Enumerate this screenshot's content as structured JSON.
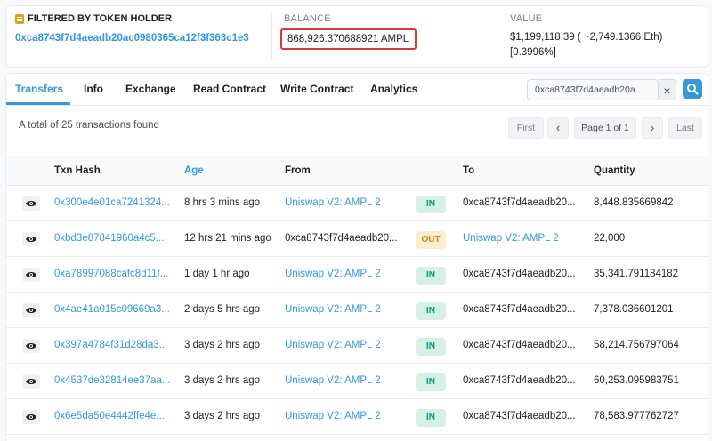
{
  "summary": {
    "filter_label": "FILTERED BY TOKEN HOLDER",
    "holder_address": "0xca8743f7d4aeadb20ac0980365ca12f3f363c1e3",
    "balance_label": "BALANCE",
    "balance_value": "868,926.370688921 AMPL",
    "value_label": "VALUE",
    "value_line1": "$1,199,118.39 ( ~2,749.1366 Eth)",
    "value_line2": "[0.3996%]"
  },
  "tabs": [
    "Transfers",
    "Info",
    "Exchange",
    "Read Contract",
    "Write Contract",
    "Analytics"
  ],
  "search": {
    "value": "0xca8743f7d4aeadb20a...",
    "clear": "×"
  },
  "found_text": "A total of 25 transactions found",
  "pager": {
    "first": "First",
    "prev": "‹",
    "info": "Page 1 of 1",
    "next": "›",
    "last": "Last"
  },
  "columns": {
    "hash": "Txn Hash",
    "age": "Age",
    "from": "From",
    "to": "To",
    "qty": "Quantity"
  },
  "rows": [
    {
      "hash": "0x300e4e01ca7241324...",
      "age": "8 hrs 3 mins ago",
      "from": "Uniswap V2: AMPL 2",
      "dir": "IN",
      "to": "0xca8743f7d4aeadb20...",
      "qty": "8,448.835669842"
    },
    {
      "hash": "0xbd3e87841960a4c5...",
      "age": "12 hrs 21 mins ago",
      "from": "0xca8743f7d4aeadb20...",
      "dir": "OUT",
      "to": "Uniswap V2: AMPL 2",
      "qty": "22,000"
    },
    {
      "hash": "0xa78997088cafc8d11f...",
      "age": "1 day 1 hr ago",
      "from": "Uniswap V2: AMPL 2",
      "dir": "IN",
      "to": "0xca8743f7d4aeadb20...",
      "qty": "35,341.791184182"
    },
    {
      "hash": "0x4ae41a015c09669a3...",
      "age": "2 days 5 hrs ago",
      "from": "Uniswap V2: AMPL 2",
      "dir": "IN",
      "to": "0xca8743f7d4aeadb20...",
      "qty": "7,378.036601201"
    },
    {
      "hash": "0x397a4784f31d28da3...",
      "age": "3 days 2 hrs ago",
      "from": "Uniswap V2: AMPL 2",
      "dir": "IN",
      "to": "0xca8743f7d4aeadb20...",
      "qty": "58,214.756797064"
    },
    {
      "hash": "0x4537de32814ee37aa...",
      "age": "3 days 2 hrs ago",
      "from": "Uniswap V2: AMPL 2",
      "dir": "IN",
      "to": "0xca8743f7d4aeadb20...",
      "qty": "60,253.095983751"
    },
    {
      "hash": "0x6e5da50e4442ffe4e...",
      "age": "3 days 2 hrs ago",
      "from": "Uniswap V2: AMPL 2",
      "dir": "IN",
      "to": "0xca8743f7d4aeadb20...",
      "qty": "78,583.977762727"
    }
  ],
  "colors": {
    "accent": "#3498db",
    "in_badge": "#00a186",
    "out_badge": "#c48a17",
    "highlight_border": "#d83a3a"
  },
  "icons": {
    "filter": "filter-icon",
    "eye": "eye-icon",
    "search": "search-icon",
    "clear": "close-icon"
  }
}
